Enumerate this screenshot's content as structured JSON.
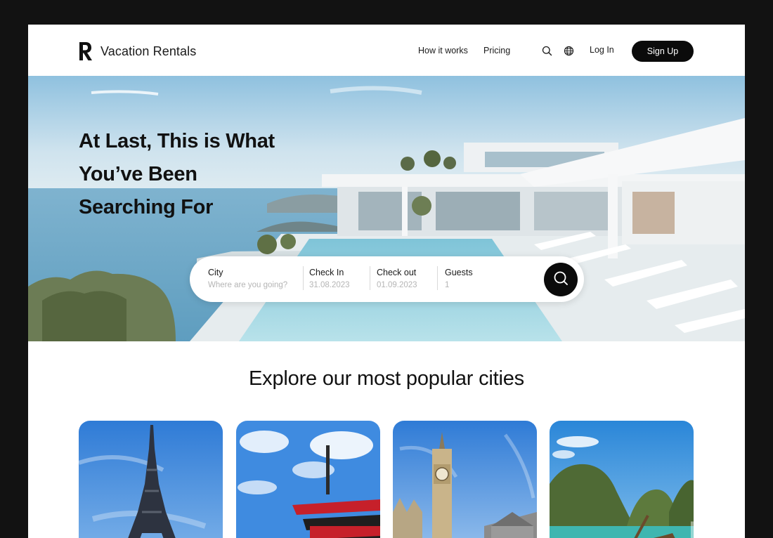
{
  "header": {
    "brand": "Vacation Rentals",
    "logo_icon": "vacation-rentals-logo-icon",
    "nav": [
      {
        "label": "How it works"
      },
      {
        "label": "Pricing"
      }
    ],
    "search_icon": "search-icon",
    "language_icon": "globe-icon",
    "login_label": "Log In",
    "signup_label": "Sign Up"
  },
  "hero": {
    "title_lines": [
      "At Last, This is What",
      "You’ve Been",
      "Searching For"
    ],
    "search": {
      "city": {
        "label": "City",
        "placeholder": "Where are you going?"
      },
      "check_in": {
        "label": "Check In",
        "value": "31.08.2023"
      },
      "check_out": {
        "label": "Check out",
        "value": "01.09.2023"
      },
      "guests": {
        "label": "Guests",
        "value": "1"
      },
      "submit_icon": "search-icon"
    }
  },
  "popular": {
    "title": "Explore our most popular cities",
    "cities": [
      {
        "image": "eiffel-tower-photo"
      },
      {
        "image": "japanese-pagoda-photo"
      },
      {
        "image": "big-ben-photo"
      },
      {
        "image": "tropical-cliffs-boat-photo"
      }
    ]
  },
  "colors": {
    "primary_button": "#0b0b0b",
    "text": "#111111",
    "placeholder": "#b5b5b5",
    "background_outer": "#121212"
  }
}
